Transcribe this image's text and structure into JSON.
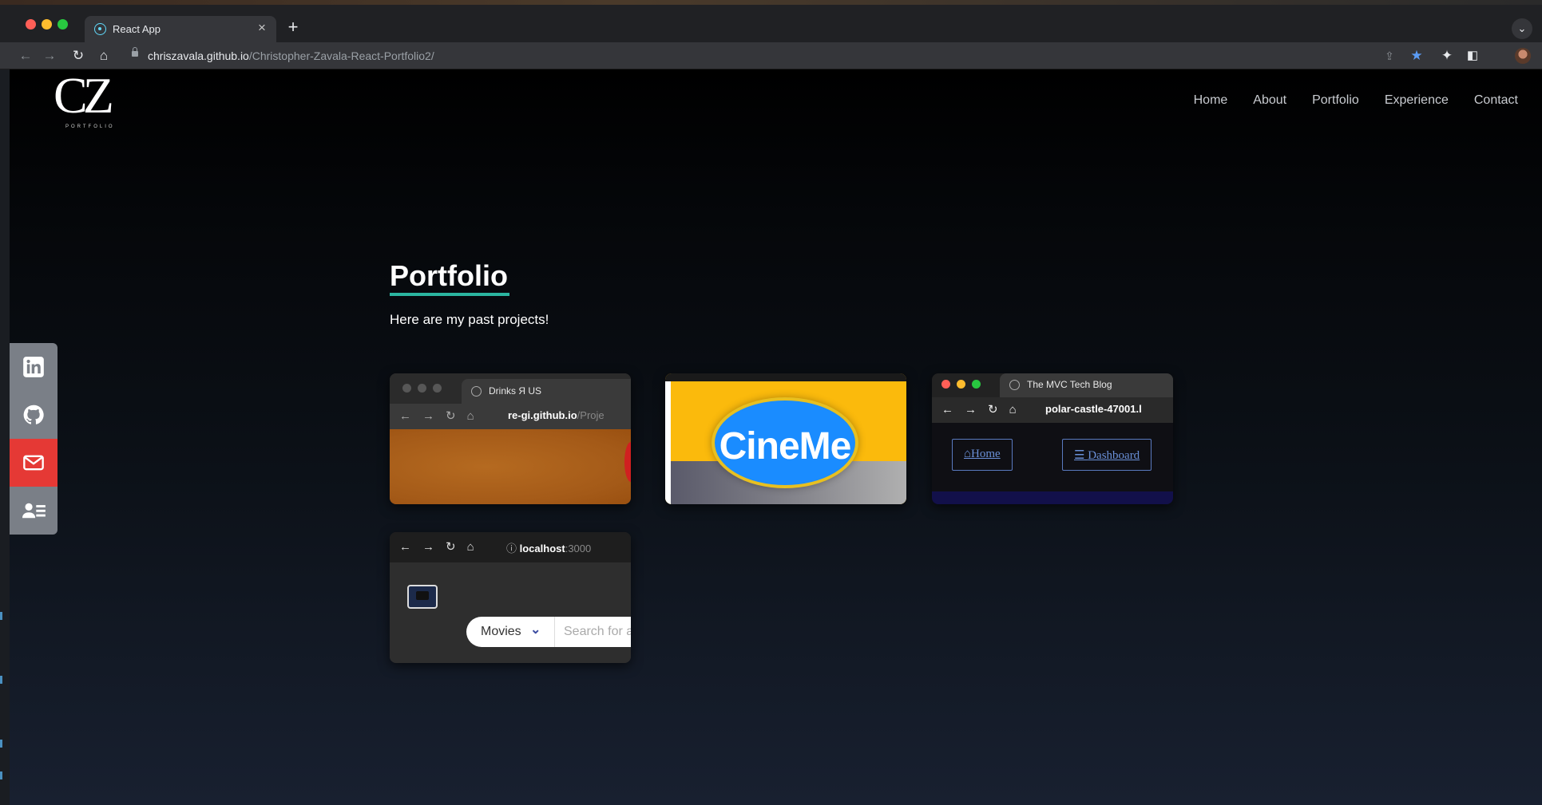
{
  "browser": {
    "tab": {
      "title": "React App"
    },
    "new_tab_label": "+",
    "tab_close_label": "×",
    "url_host": "chriszavala.github.io",
    "url_path": "/Christopher-Zavala-React-Portfolio2/"
  },
  "site": {
    "logo": {
      "monogram": "CZ",
      "subtitle": "PORTFOLIO"
    },
    "nav": [
      "Home",
      "About",
      "Portfolio",
      "Experience",
      "Contact"
    ],
    "social": [
      {
        "icon": "linkedin-icon"
      },
      {
        "icon": "github-icon"
      },
      {
        "icon": "mail-icon",
        "color": "#e53935"
      },
      {
        "icon": "contact-card-icon"
      }
    ]
  },
  "portfolio": {
    "title": "Portfolio",
    "subtitle": "Here are my past projects!",
    "accent_color": "#2bb5a0",
    "projects": [
      {
        "tab_title": "Drinks Я US",
        "url_host": "re-gi.github.io",
        "url_path": "/Proje"
      },
      {
        "logo_text": "CineMe"
      },
      {
        "tab_title": "The MVC Tech Blog",
        "url_host": "polar-castle-47001.l",
        "nav_home": "Home",
        "nav_dashboard": "Dashboard"
      },
      {
        "url_host": "localhost",
        "url_port": ":3000",
        "select_value": "Movies",
        "search_placeholder": "Search for a"
      }
    ]
  }
}
